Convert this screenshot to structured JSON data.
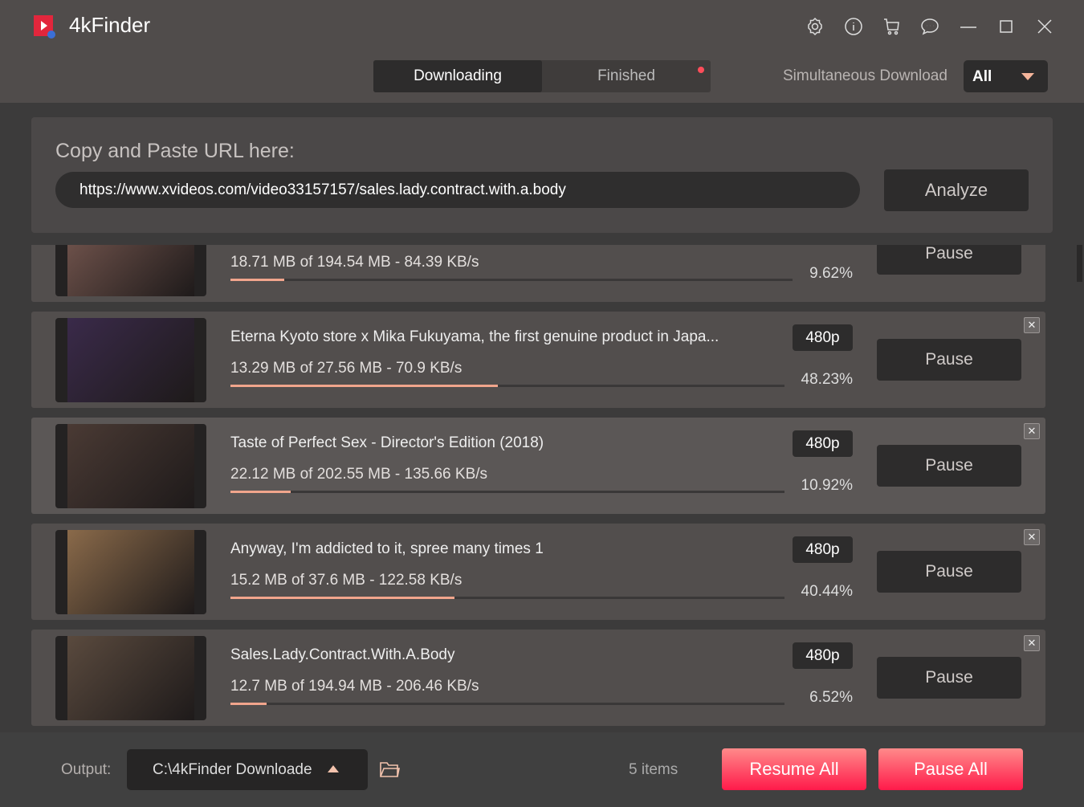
{
  "app": {
    "title": "4kFinder"
  },
  "titlebar_icons": [
    "gear-icon",
    "info-icon",
    "cart-icon",
    "chat-icon",
    "minimize-icon",
    "maximize-icon",
    "close-icon"
  ],
  "tabs": [
    {
      "label": "Downloading",
      "active": true
    },
    {
      "label": "Finished",
      "has_notification": true
    }
  ],
  "simultaneous": {
    "label": "Simultaneous Download",
    "value": "All"
  },
  "url": {
    "label": "Copy and Paste URL here:",
    "value": "https://www.xvideos.com/video33157157/sales.lady.contract.with.a.body",
    "analyze_label": "Analyze"
  },
  "items": [
    {
      "title": "",
      "progress_text": "18.71 MB of 194.54 MB - 84.39 KB/s",
      "percent": "9.62%",
      "progress": 9.62,
      "resolution": "",
      "pause_label": "Pause"
    },
    {
      "title": "Eterna Kyoto store x Mika Fukuyama, the first genuine product in Japa...",
      "progress_text": "13.29 MB of 27.56 MB - 70.9 KB/s",
      "percent": "48.23%",
      "progress": 48.23,
      "resolution": "480p",
      "pause_label": "Pause"
    },
    {
      "title": "Taste of Perfect Sex - Director's Edition (2018)",
      "progress_text": "22.12 MB of 202.55 MB - 135.66 KB/s",
      "percent": "10.92%",
      "progress": 10.92,
      "resolution": "480p",
      "pause_label": "Pause"
    },
    {
      "title": "Anyway, I'm addicted to it, spree many times 1",
      "progress_text": "15.2 MB of 37.6 MB - 122.58 KB/s",
      "percent": "40.44%",
      "progress": 40.44,
      "resolution": "480p",
      "pause_label": "Pause"
    },
    {
      "title": "Sales.Lady.Contract.With.A.Body",
      "progress_text": "12.7 MB of 194.94 MB - 206.46 KB/s",
      "percent": "6.52%",
      "progress": 6.52,
      "resolution": "480p",
      "pause_label": "Pause"
    }
  ],
  "footer": {
    "output_label": "Output:",
    "output_path": "C:\\4kFinder Downloade",
    "count": "5 items",
    "resume_all": "Resume All",
    "pause_all": "Pause All"
  },
  "colors": {
    "accent": "#f1a58c",
    "button_red": "#ff1a4a",
    "notification": "#ff4d5a"
  }
}
